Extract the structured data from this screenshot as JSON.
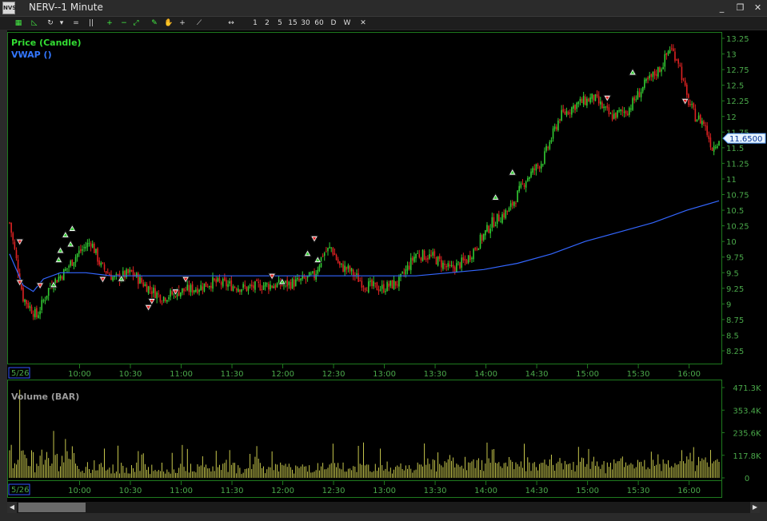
{
  "window": {
    "title": "NERV--1 Minute",
    "icon_label": "NVS",
    "minimize": "_",
    "restore": "❐",
    "close": "✕"
  },
  "toolbar": {
    "buttons": [
      {
        "name": "candles-sun-button",
        "label": "▦"
      },
      {
        "name": "line-chart-button",
        "label": "◺"
      },
      {
        "name": "refresh-button",
        "label": "↻"
      },
      {
        "name": "dropdown-button",
        "label": "▾"
      },
      {
        "name": "equal-spacing-button",
        "label": "="
      },
      {
        "name": "columns-button",
        "label": "||"
      },
      {
        "name": "zoom-in-button",
        "label": "+"
      },
      {
        "name": "zoom-out-button",
        "label": "−"
      },
      {
        "name": "fit-button",
        "label": "⤢"
      },
      {
        "name": "draw-pen-button",
        "label": "✎"
      },
      {
        "name": "hand-button",
        "label": "✋"
      },
      {
        "name": "crosshair-button",
        "label": "+"
      },
      {
        "name": "trendline-button",
        "label": "⟋"
      },
      {
        "name": "pan-button",
        "label": "↔"
      }
    ],
    "periods": [
      "1",
      "2",
      "5",
      "15",
      "30",
      "60",
      "D",
      "W"
    ],
    "close_label": "✕"
  },
  "price_panel": {
    "legend_price": "Price (Candle)",
    "legend_vwap": "VWAP ()",
    "y_ticks": [
      "13.25",
      "13",
      "12.75",
      "12.5",
      "12.25",
      "12",
      "11.75",
      "11.5",
      "11.25",
      "11",
      "10.75",
      "10.5",
      "10.25",
      "10",
      "9.75",
      "9.5",
      "9.25",
      "9",
      "8.75",
      "8.5",
      "8.25"
    ],
    "y_values": [
      13.25,
      13,
      12.75,
      12.5,
      12.25,
      12,
      11.75,
      11.5,
      11.25,
      11,
      10.75,
      10.5,
      10.25,
      10,
      9.75,
      9.5,
      9.25,
      9,
      8.75,
      8.5,
      8.25
    ],
    "last_price_label": "11.6500",
    "last_price": 11.65,
    "date_label": "5/26"
  },
  "volume_panel": {
    "legend": "Volume (BAR)",
    "y_ticks": [
      "471.3K",
      "353.4K",
      "235.6K",
      "117.8K",
      "0"
    ],
    "date_label": "5/26"
  },
  "x_ticks": [
    "10:00",
    "10:30",
    "11:00",
    "11:30",
    "12:00",
    "12:30",
    "13:00",
    "13:30",
    "14:00",
    "14:30",
    "15:00",
    "15:30",
    "16:00"
  ],
  "colors": {
    "up": "#33cc33",
    "down": "#dd2222",
    "vwap": "#3366ff",
    "volume": "#dddd55",
    "axis": "#1e7a1e",
    "tick_text": "#4aa84a",
    "legend_price": "#33dd33",
    "legend_vwap": "#3377ff"
  },
  "chart_data": {
    "type": "candlestick",
    "interval": "1 Minute",
    "symbol": "NERV",
    "price_range": [
      8.1,
      13.35
    ],
    "volume_range": [
      0,
      471300
    ],
    "close_path": [
      [
        0,
        10.3
      ],
      [
        8,
        9.1
      ],
      [
        16,
        8.8
      ],
      [
        24,
        9.3
      ],
      [
        32,
        9.5
      ],
      [
        40,
        9.8
      ],
      [
        48,
        10.0
      ],
      [
        54,
        9.6
      ],
      [
        62,
        9.4
      ],
      [
        72,
        9.5
      ],
      [
        80,
        9.3
      ],
      [
        90,
        9.1
      ],
      [
        100,
        9.2
      ],
      [
        110,
        9.25
      ],
      [
        120,
        9.35
      ],
      [
        130,
        9.3
      ],
      [
        140,
        9.25
      ],
      [
        150,
        9.3
      ],
      [
        160,
        9.3
      ],
      [
        170,
        9.35
      ],
      [
        180,
        9.45
      ],
      [
        185,
        9.8
      ],
      [
        190,
        9.9
      ],
      [
        195,
        9.6
      ],
      [
        200,
        9.55
      ],
      [
        210,
        9.3
      ],
      [
        220,
        9.25
      ],
      [
        230,
        9.35
      ],
      [
        240,
        9.8
      ],
      [
        250,
        9.75
      ],
      [
        260,
        9.55
      ],
      [
        270,
        9.7
      ],
      [
        285,
        10.3
      ],
      [
        295,
        10.5
      ],
      [
        305,
        11.0
      ],
      [
        315,
        11.3
      ],
      [
        325,
        12.0
      ],
      [
        335,
        12.2
      ],
      [
        345,
        12.3
      ],
      [
        355,
        12.0
      ],
      [
        365,
        12.1
      ],
      [
        375,
        12.5
      ],
      [
        385,
        12.8
      ],
      [
        390,
        13.1
      ],
      [
        395,
        12.9
      ],
      [
        400,
        12.3
      ],
      [
        405,
        12.0
      ],
      [
        410,
        11.9
      ],
      [
        415,
        11.5
      ],
      [
        419,
        11.65
      ]
    ],
    "vwap_path": [
      [
        0,
        9.8
      ],
      [
        8,
        9.3
      ],
      [
        14,
        9.2
      ],
      [
        20,
        9.4
      ],
      [
        30,
        9.5
      ],
      [
        45,
        9.5
      ],
      [
        60,
        9.45
      ],
      [
        80,
        9.45
      ],
      [
        110,
        9.45
      ],
      [
        150,
        9.45
      ],
      [
        180,
        9.45
      ],
      [
        210,
        9.45
      ],
      [
        240,
        9.45
      ],
      [
        260,
        9.5
      ],
      [
        280,
        9.55
      ],
      [
        300,
        9.65
      ],
      [
        320,
        9.8
      ],
      [
        340,
        10.0
      ],
      [
        360,
        10.15
      ],
      [
        380,
        10.3
      ],
      [
        400,
        10.5
      ],
      [
        419,
        10.65
      ]
    ],
    "signals": [
      {
        "bar": 6,
        "type": "sell",
        "price": 10.0
      },
      {
        "bar": 6,
        "type": "sell",
        "price": 9.35
      },
      {
        "bar": 18,
        "type": "sell",
        "price": 9.3
      },
      {
        "bar": 26,
        "type": "buy",
        "price": 9.3
      },
      {
        "bar": 29,
        "type": "buy",
        "price": 9.7
      },
      {
        "bar": 30,
        "type": "buy",
        "price": 9.85
      },
      {
        "bar": 33,
        "type": "buy",
        "price": 10.1
      },
      {
        "bar": 36,
        "type": "buy",
        "price": 9.95
      },
      {
        "bar": 37,
        "type": "buy",
        "price": 10.2
      },
      {
        "bar": 55,
        "type": "sell",
        "price": 9.4
      },
      {
        "bar": 66,
        "type": "buy",
        "price": 9.4
      },
      {
        "bar": 82,
        "type": "sell",
        "price": 8.95
      },
      {
        "bar": 84,
        "type": "sell",
        "price": 9.05
      },
      {
        "bar": 98,
        "type": "sell",
        "price": 9.2
      },
      {
        "bar": 104,
        "type": "sell",
        "price": 9.4
      },
      {
        "bar": 155,
        "type": "sell",
        "price": 9.45
      },
      {
        "bar": 161,
        "type": "buy",
        "price": 9.35
      },
      {
        "bar": 176,
        "type": "buy",
        "price": 9.8
      },
      {
        "bar": 180,
        "type": "sell",
        "price": 10.05
      },
      {
        "bar": 182,
        "type": "buy",
        "price": 9.7
      },
      {
        "bar": 287,
        "type": "buy",
        "price": 10.7
      },
      {
        "bar": 297,
        "type": "buy",
        "price": 11.1
      },
      {
        "bar": 353,
        "type": "sell",
        "price": 12.3
      },
      {
        "bar": 368,
        "type": "buy",
        "price": 12.7
      },
      {
        "bar": 399,
        "type": "sell",
        "price": 12.25
      }
    ]
  }
}
